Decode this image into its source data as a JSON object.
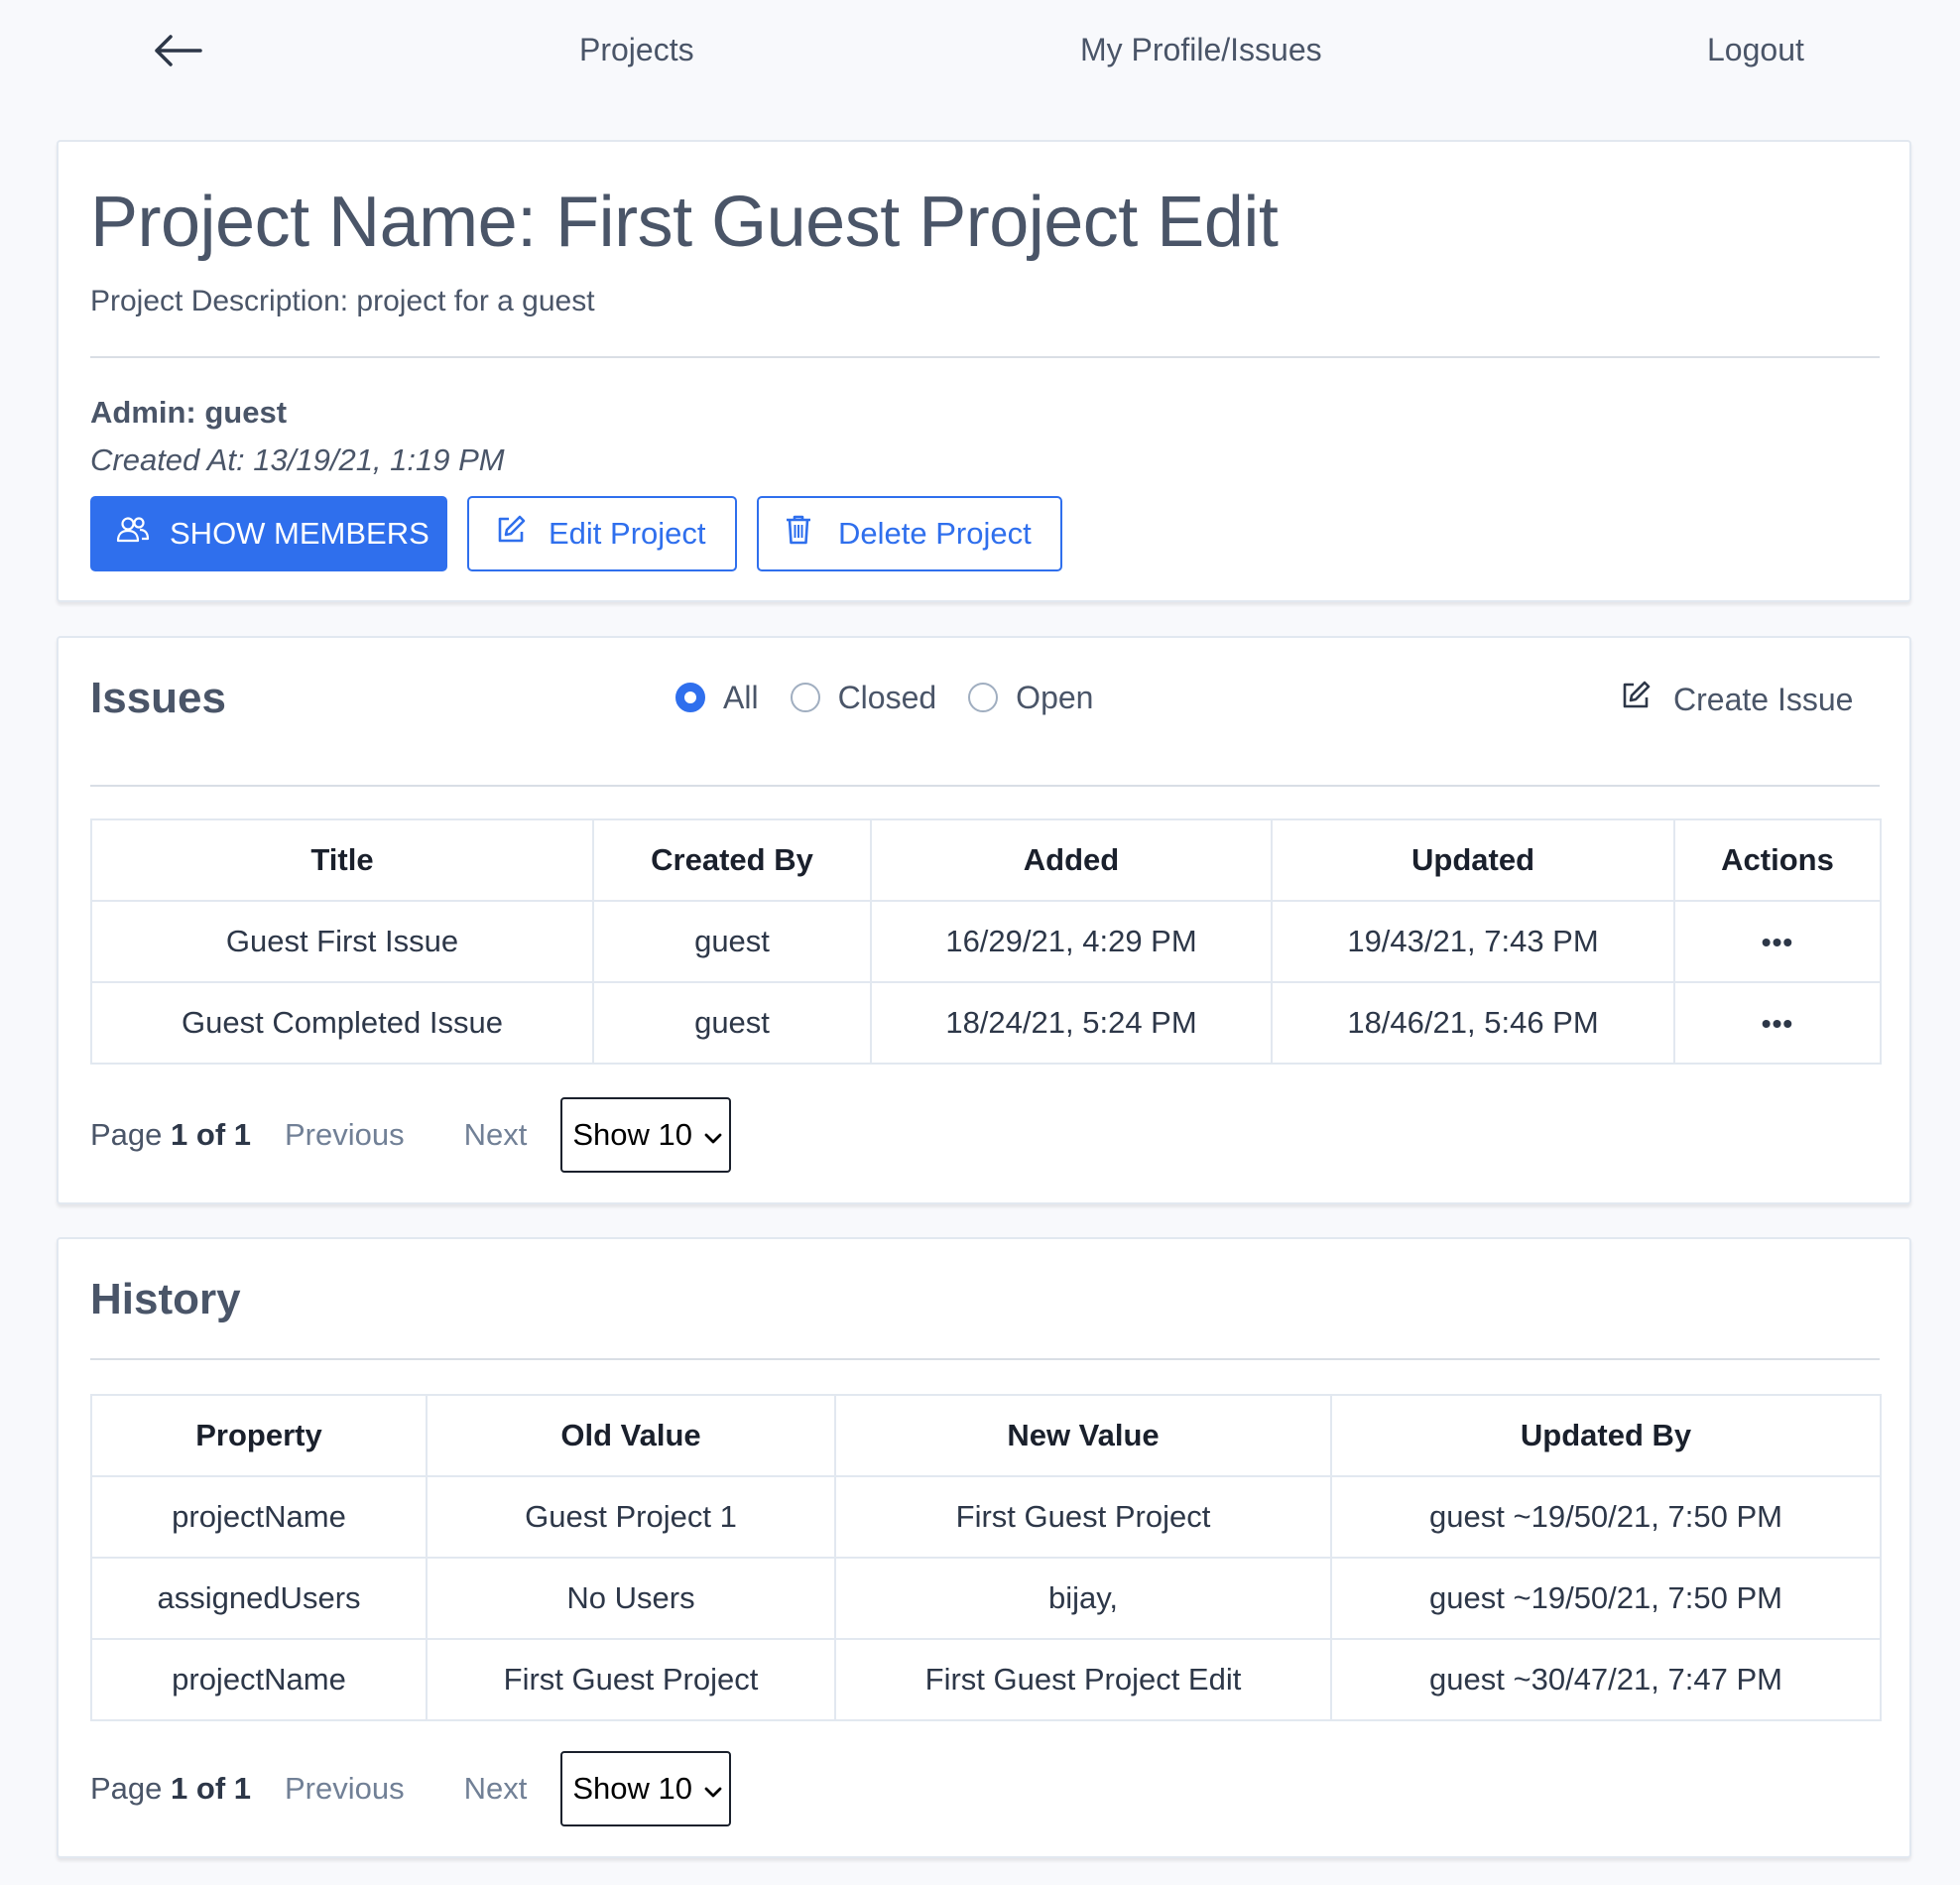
{
  "nav": {
    "back_icon": "arrow-left-icon",
    "projects": "Projects",
    "profile": "My Profile/Issues",
    "logout": "Logout"
  },
  "project": {
    "title": "Project Name: First Guest Project Edit",
    "description": "Project Description: project for a guest",
    "admin": "Admin: guest",
    "created_at": "Created At: 13/19/21, 1:19 PM",
    "buttons": {
      "show_members": "SHOW MEMBERS",
      "edit": "Edit Project",
      "delete": "Delete Project"
    },
    "accent_color": "#2f6fed"
  },
  "issues": {
    "title": "Issues",
    "filters": [
      {
        "label": "All",
        "selected": true
      },
      {
        "label": "Closed",
        "selected": false
      },
      {
        "label": "Open",
        "selected": false
      }
    ],
    "create_label": "Create Issue",
    "columns": [
      "Title",
      "Created By",
      "Added",
      "Updated",
      "Actions"
    ],
    "rows": [
      {
        "title": "Guest First Issue",
        "created_by": "guest",
        "added": "16/29/21, 4:29 PM",
        "updated": "19/43/21, 7:43 PM",
        "actions": "•••"
      },
      {
        "title": "Guest Completed Issue",
        "created_by": "guest",
        "added": "18/24/21, 5:24 PM",
        "updated": "18/46/21, 5:46 PM",
        "actions": "•••"
      }
    ],
    "pager": {
      "page_label": "Page",
      "page_value": "1 of 1",
      "previous": "Previous",
      "next": "Next",
      "show": "Show 10"
    }
  },
  "history": {
    "title": "History",
    "columns": [
      "Property",
      "Old Value",
      "New Value",
      "Updated By"
    ],
    "rows": [
      {
        "property": "projectName",
        "old": "Guest Project 1",
        "new": "First Guest Project",
        "by": "guest ~19/50/21, 7:50 PM"
      },
      {
        "property": "assignedUsers",
        "old": "No Users",
        "new": "bijay,",
        "by": "guest ~19/50/21, 7:50 PM"
      },
      {
        "property": "projectName",
        "old": "First Guest Project",
        "new": "First Guest Project Edit",
        "by": "guest ~30/47/21, 7:47 PM"
      }
    ],
    "pager": {
      "page_label": "Page",
      "page_value": "1 of 1",
      "previous": "Previous",
      "next": "Next",
      "show": "Show 10"
    }
  }
}
